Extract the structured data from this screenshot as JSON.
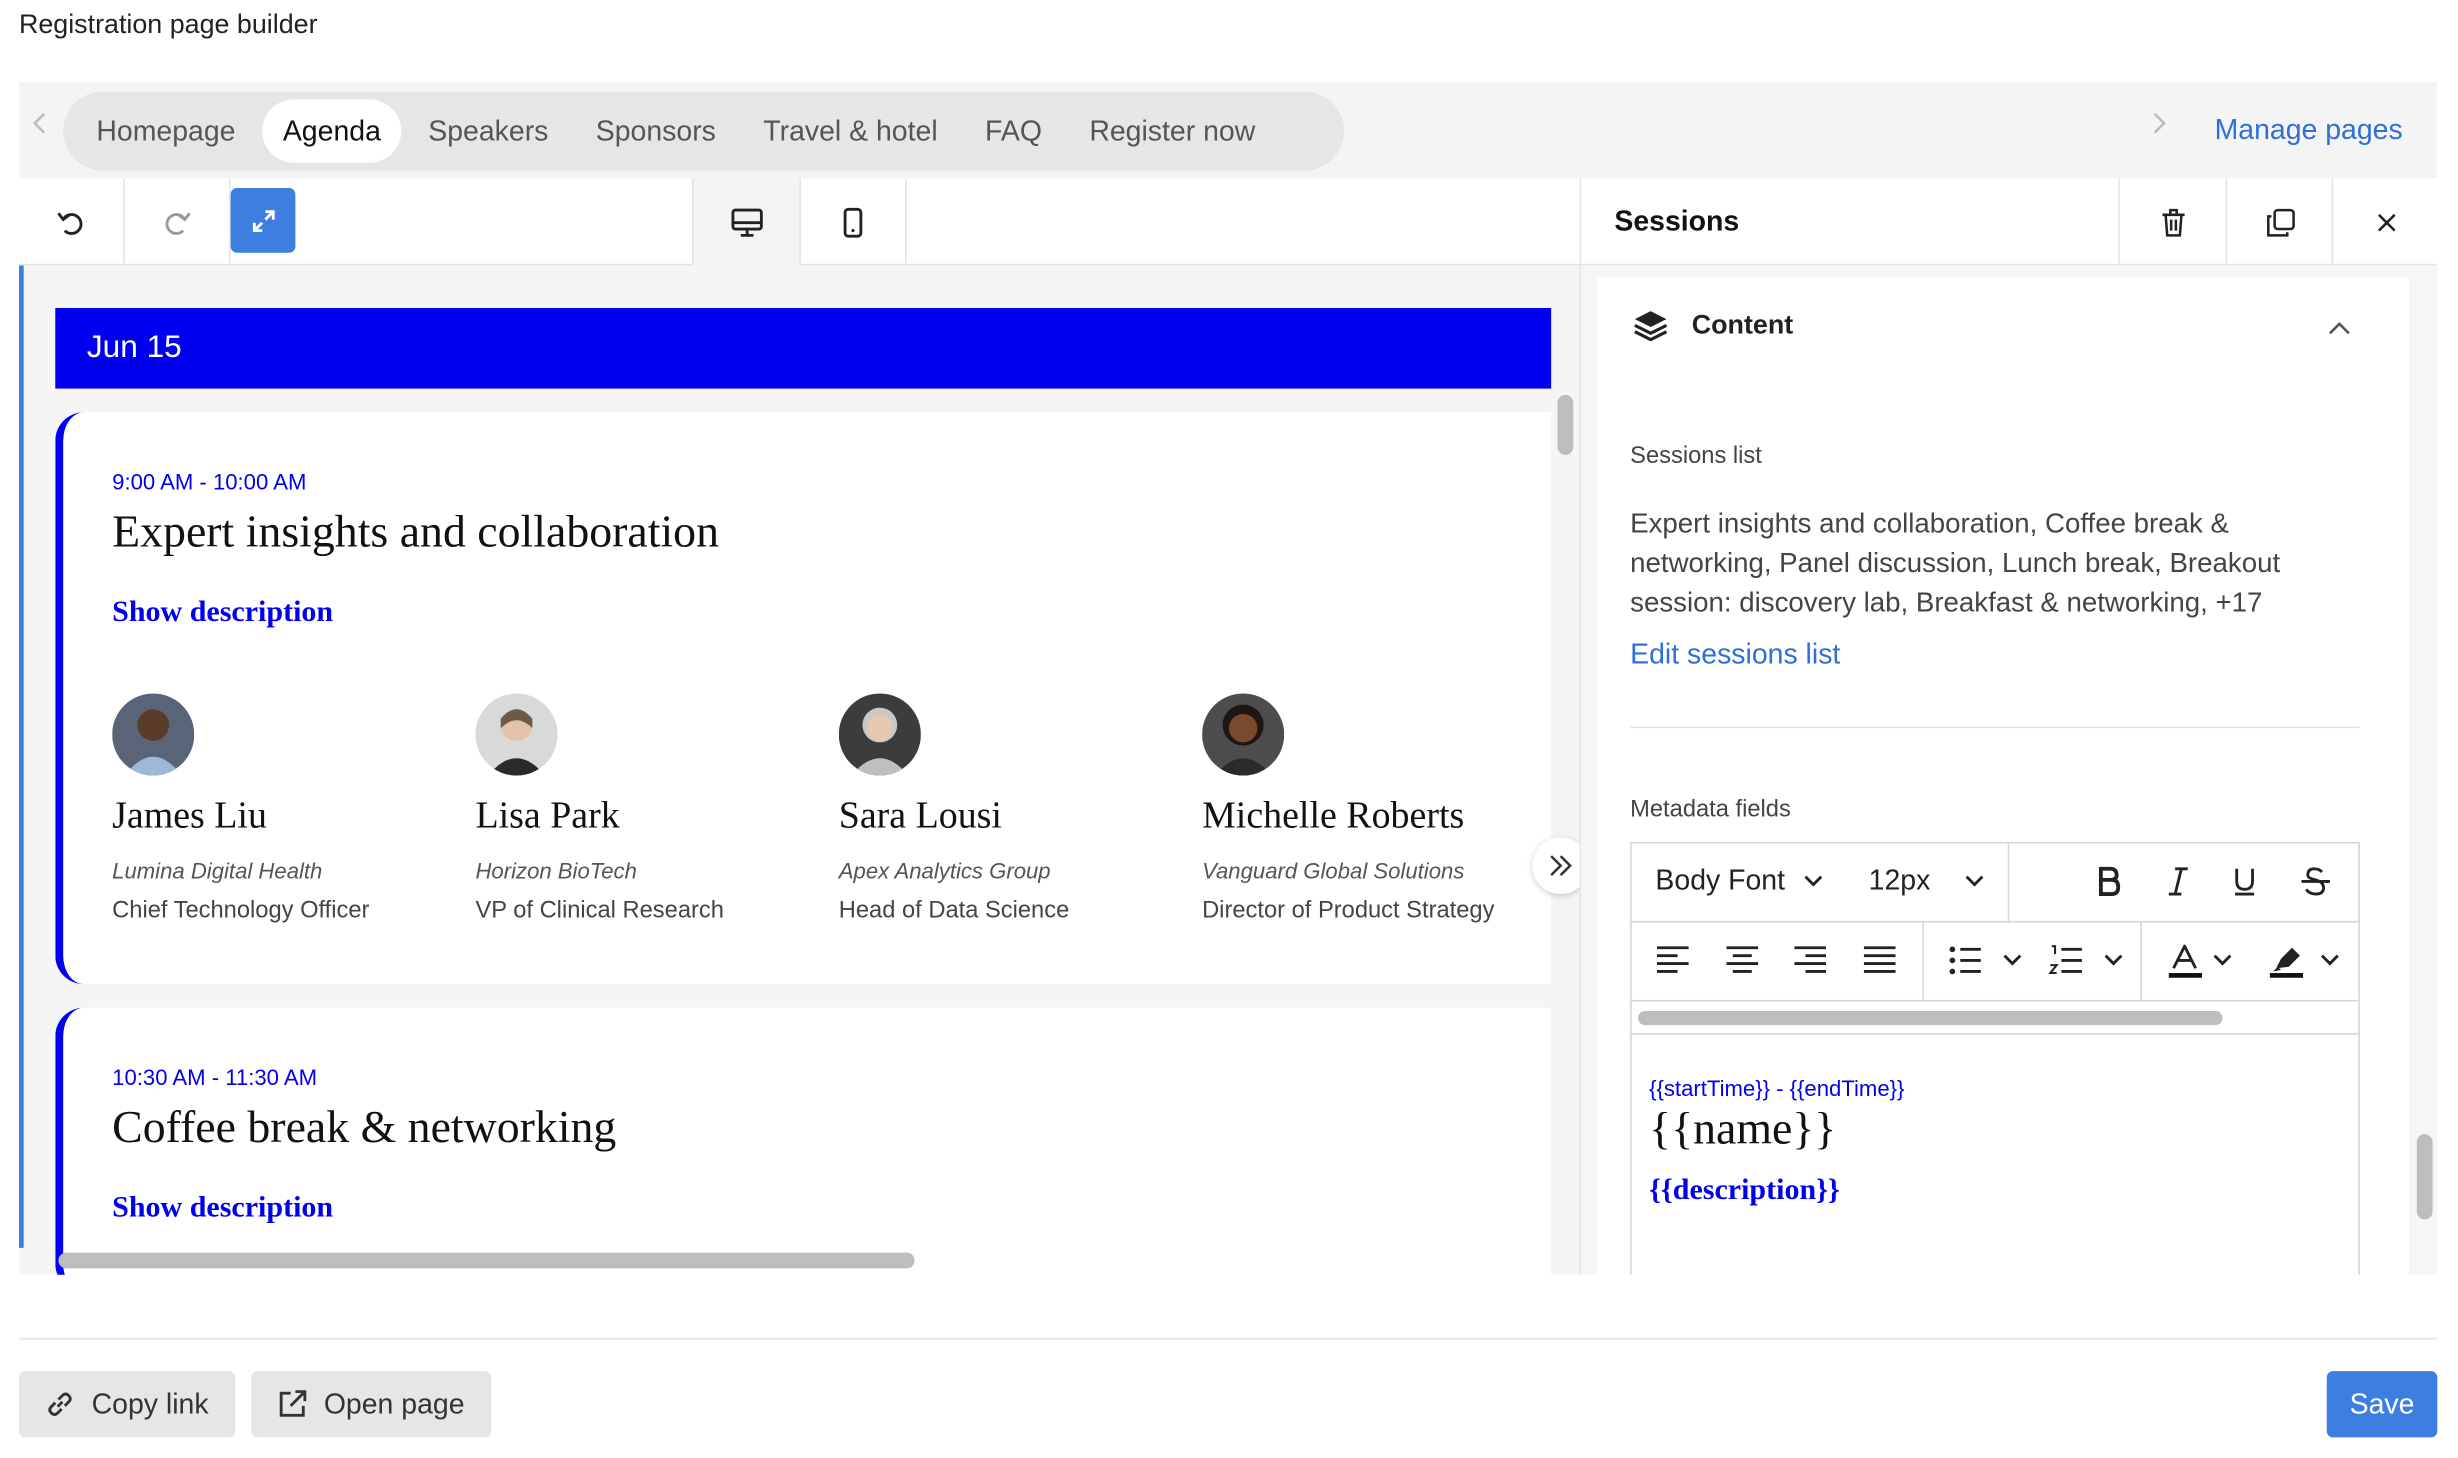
{
  "page_title": "Registration page builder",
  "tabs": [
    {
      "label": "Homepage",
      "active": false
    },
    {
      "label": "Agenda",
      "active": true
    },
    {
      "label": "Speakers",
      "active": false
    },
    {
      "label": "Sponsors",
      "active": false
    },
    {
      "label": "Travel & hotel",
      "active": false
    },
    {
      "label": "FAQ",
      "active": false
    },
    {
      "label": "Register now",
      "active": false
    }
  ],
  "manage_pages": "Manage pages",
  "agenda": {
    "date": "Jun 15",
    "sessions": [
      {
        "time": "9:00 AM - 10:00 AM",
        "title": "Expert insights and collaboration",
        "show_description": "Show description",
        "speakers": [
          {
            "name": "James Liu",
            "company": "Lumina Digital Health",
            "role": "Chief Technology Officer"
          },
          {
            "name": "Lisa Park",
            "company": "Horizon BioTech",
            "role": "VP of Clinical Research"
          },
          {
            "name": "Sara Lousi",
            "company": "Apex Analytics Group",
            "role": "Head of Data Science"
          },
          {
            "name": "Michelle Roberts",
            "company": "Vanguard Global Solutions",
            "role": "Director of Product Strategy"
          }
        ]
      },
      {
        "time": "10:30 AM - 11:30 AM",
        "title": "Coffee break & networking",
        "show_description": "Show description"
      }
    ]
  },
  "panel": {
    "title": "Sessions",
    "section": "Content",
    "sessions_list_label": "Sessions list",
    "sessions_list_value": "Expert insights and collaboration, Coffee break & networking, Panel discussion, Lunch break, Breakout session: discovery lab, Breakfast & networking, +17",
    "edit_sessions": "Edit sessions list",
    "metadata_label": "Metadata fields",
    "editor": {
      "font": "Body Font",
      "size": "12px",
      "template_time": "{{startTime}} - {{endTime}}",
      "template_name": "{{name}}",
      "template_description": "{{description}}"
    }
  },
  "footer": {
    "copy_link": "Copy link",
    "open_page": "Open page",
    "save": "Save"
  },
  "colors": {
    "accent": "#3d7fe0",
    "agenda_blue": "#0000ee",
    "link": "#2f6fd6"
  }
}
